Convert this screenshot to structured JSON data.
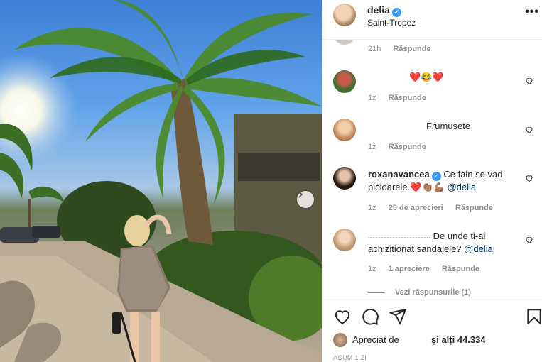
{
  "post": {
    "username": "delia",
    "location": "Saint-Tropez",
    "more_label": "•••"
  },
  "comments": [
    {
      "user": "",
      "text": "",
      "time": "21h",
      "likes": "",
      "reply": "Răspunde"
    },
    {
      "user": "",
      "text": "",
      "emoji": "❤️😂❤️",
      "time": "1z",
      "likes": "",
      "reply": "Răspunde"
    },
    {
      "user": "",
      "text": "Frumusete",
      "time": "1z",
      "likes": "",
      "reply": "Răspunde"
    },
    {
      "user": "roxanavancea",
      "text": "Ce fain se vad picioarele",
      "emoji": "❤️👏🏽💪🏽",
      "mention": "@delia",
      "time": "1z",
      "likes": "25 de aprecieri",
      "reply": "Răspunde"
    },
    {
      "user": "",
      "text": "De unde ti-ai achizitionat sandalele?",
      "mention": "@delia",
      "time": "1z",
      "likes": "1 apreciere",
      "reply": "Răspunde"
    }
  ],
  "view_replies": "Vezi răspunsurile (1)",
  "likes_section": {
    "prefix": "Apreciat de",
    "suffix": "și alți 44.334"
  },
  "timestamp": "ACUM 1 ZI",
  "colors": {
    "verified": "#3897f0",
    "mention": "#00376b",
    "muted": "#8e8e8e"
  },
  "icons": [
    "more-icon",
    "heart-icon",
    "comment-icon",
    "share-icon",
    "bookmark-icon",
    "chevron-right-icon",
    "verified-icon"
  ]
}
